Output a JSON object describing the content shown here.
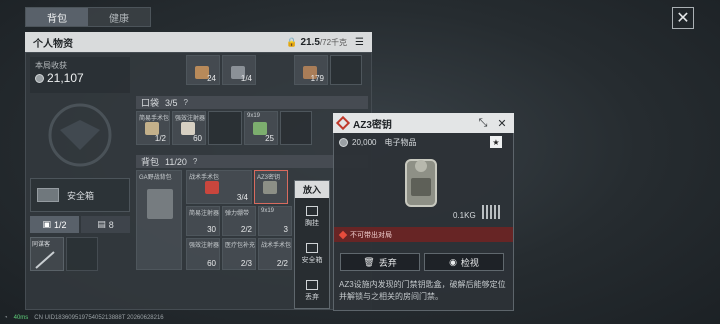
{
  "tabs": [
    {
      "label": "背包"
    },
    {
      "label": "健康"
    }
  ],
  "personal": {
    "title": "个人物资",
    "weight": "21.5",
    "weight_max": "/72千克"
  },
  "income": {
    "label": "本局收获",
    "value": "21,107"
  },
  "safe_box": {
    "label": "安全箱"
  },
  "sub_tabs": {
    "box": "1/2",
    "other": "8"
  },
  "melee_item": {
    "label": "同谋客"
  },
  "top_slots": [
    {
      "count": "24"
    },
    {
      "count": "1/4"
    },
    {
      "count": "179"
    }
  ],
  "pocket": {
    "label": "口袋",
    "capacity": "3/5",
    "help": "?"
  },
  "pocket_items": [
    {
      "name": "简易手术包",
      "count": "1/2"
    },
    {
      "name": "强效注射器",
      "count": "60"
    },
    {
      "name": "9x19",
      "count": "25"
    }
  ],
  "backpack": {
    "label": "背包",
    "capacity": "11/20",
    "help": "?"
  },
  "backpack_items": [
    {
      "name": "GA野战背包",
      "count": ""
    },
    {
      "name": "战术手术包",
      "count": "3/4"
    },
    {
      "name": "AZ3密钥",
      "count": ""
    },
    {
      "name": "简易注射器",
      "count": "30"
    },
    {
      "name": "弹力绷带",
      "count": "2/2"
    },
    {
      "name": "9x19",
      "count": "3"
    },
    {
      "name": "强效注射器",
      "count": "60"
    },
    {
      "name": "医疗包补充",
      "count": "2/3"
    },
    {
      "name": "战术手术包",
      "count": "2/2"
    }
  ],
  "context_menu": {
    "title": "放入",
    "items": [
      {
        "label": "胸挂"
      },
      {
        "label": "安全箱"
      },
      {
        "label": "丢弃"
      }
    ]
  },
  "detail": {
    "title": "AZ3密钥",
    "price": "20,000",
    "category": "电子物品",
    "weight": "0.1KG",
    "warning": "不可带出对局",
    "discard_label": "丢弃",
    "inspect_label": "检视",
    "description": "AZ3设施内发现的门禁钥匙盒，破解后能够定位并解锁与之相关的房间门禁。"
  },
  "status": {
    "ping": "40ms",
    "uid": "CN UID18360951975405213888T 20260628216"
  },
  "colors": {
    "accent_red": "#c0392b",
    "panel": "#343a3f",
    "header": "#d9dbdc"
  }
}
